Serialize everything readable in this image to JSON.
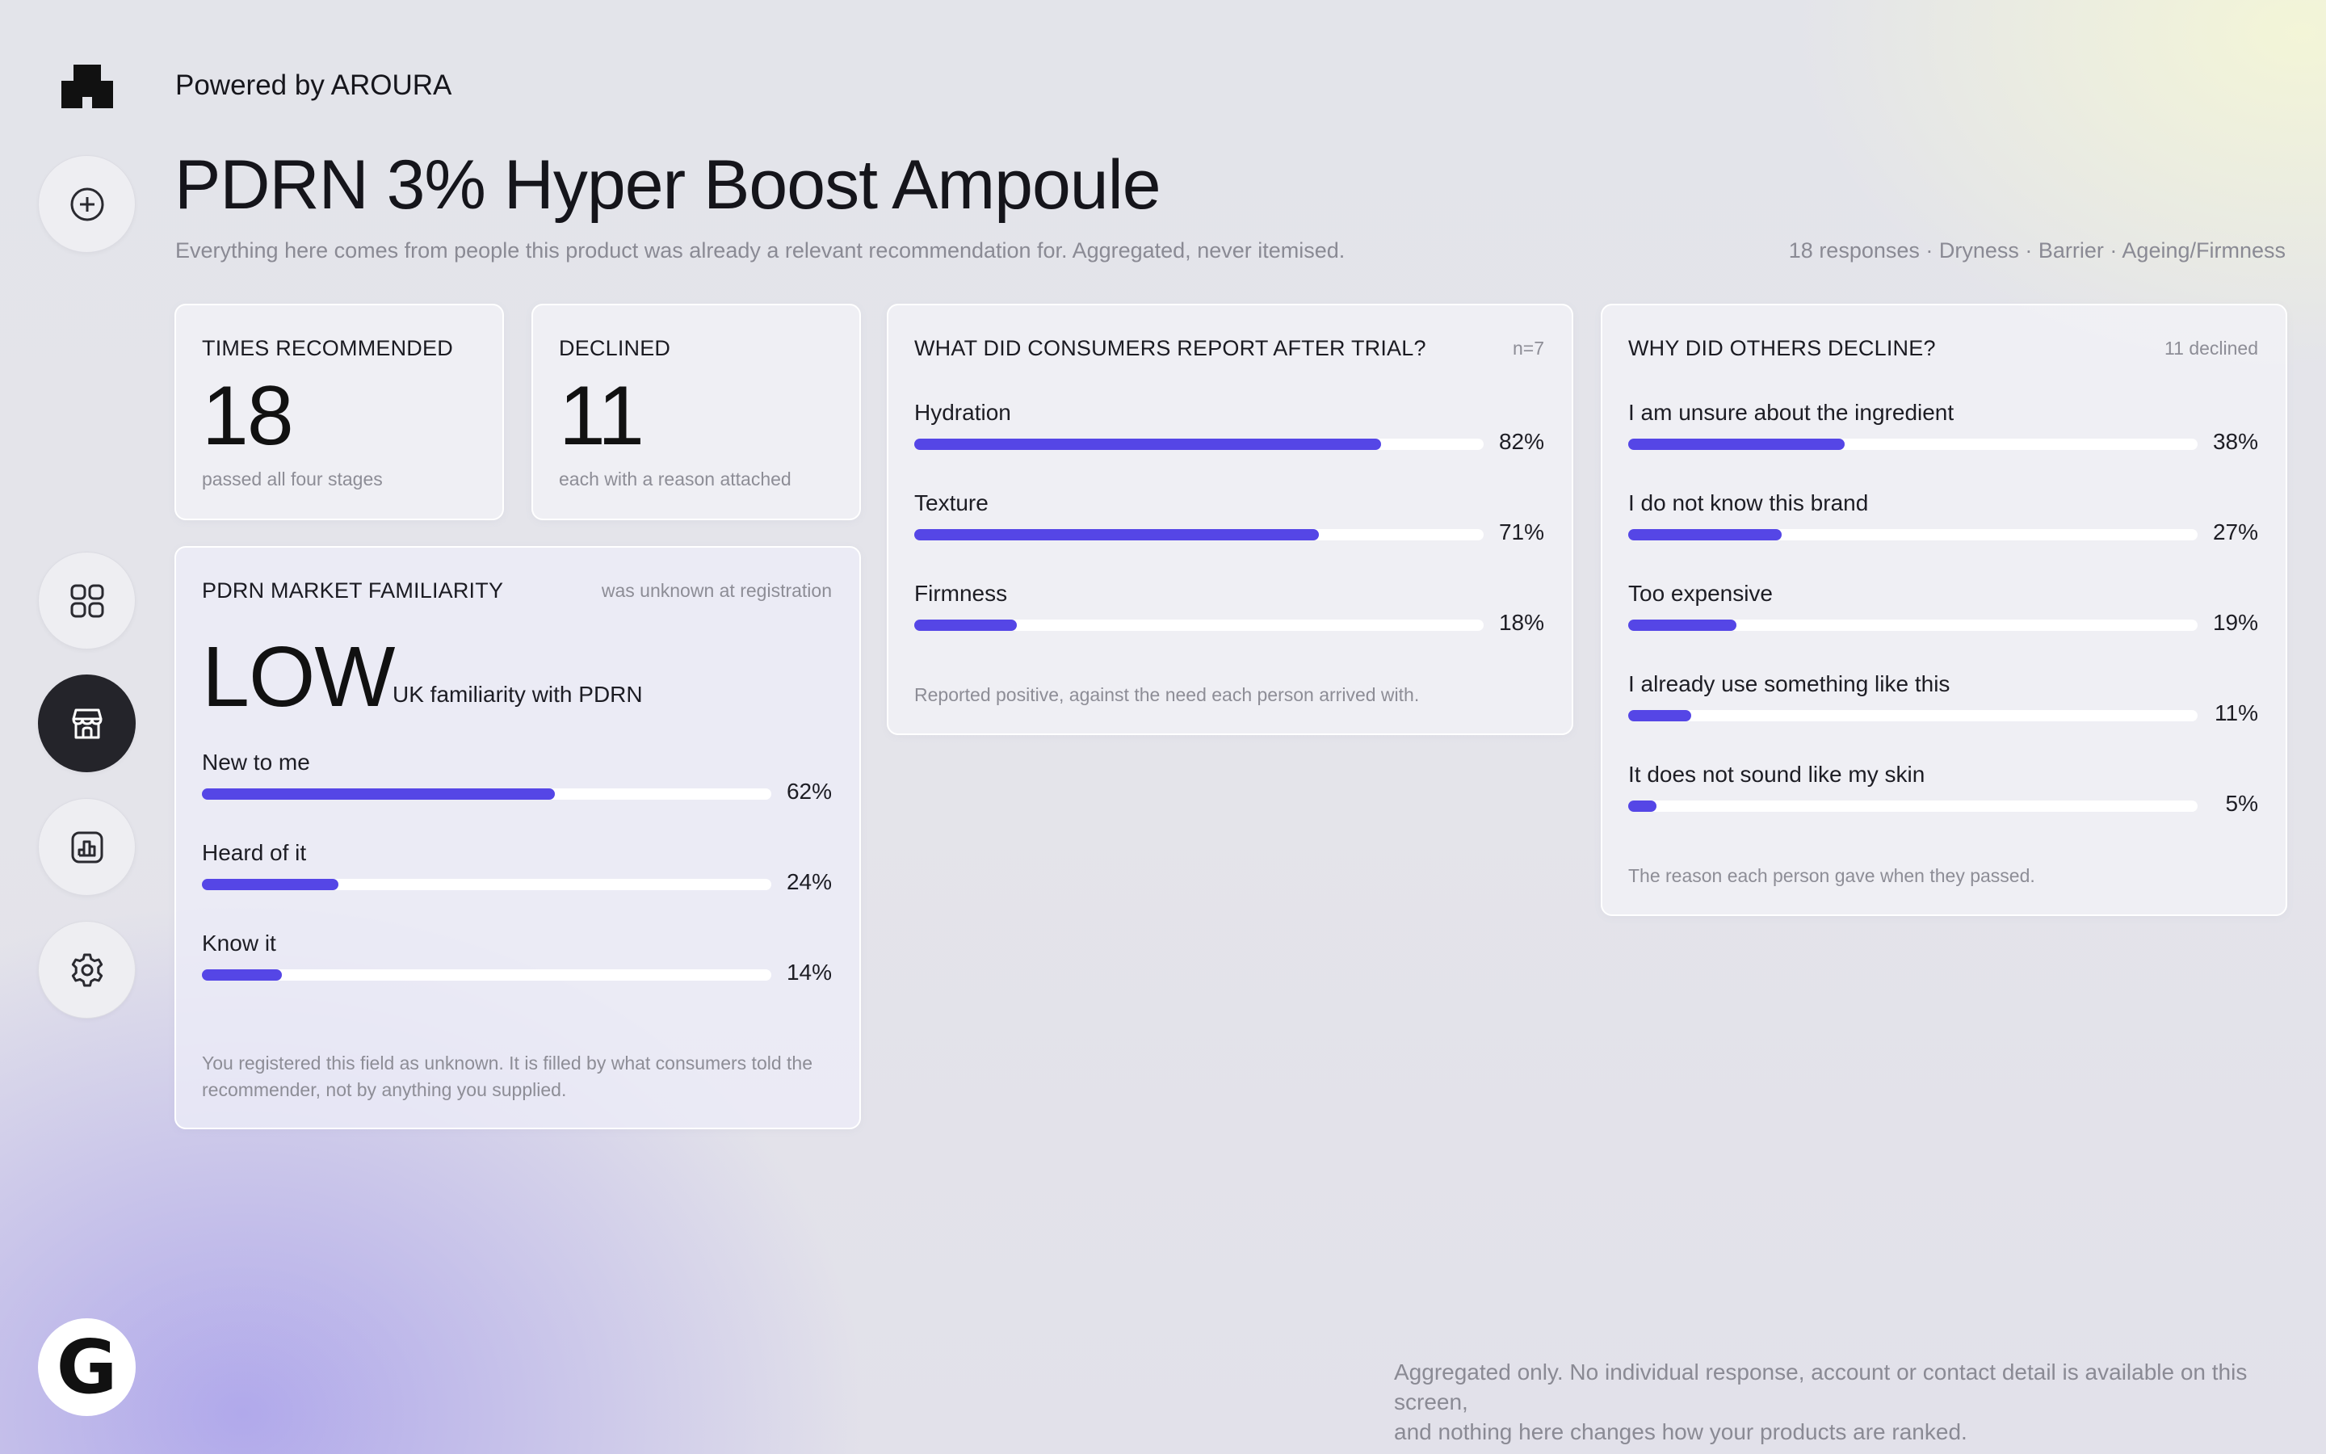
{
  "header": {
    "powered_by": "Powered by AROURA",
    "title": "PDRN 3% Hyper Boost Ampoule",
    "subtitle": "Everything here comes from people this product was already a relevant recommendation for. Aggregated, never itemised.",
    "meta": "18 responses · Dryness · Barrier · Ageing/Firmness"
  },
  "rail": {
    "items": [
      {
        "name": "add",
        "icon": "plus-circle-icon"
      },
      {
        "name": "dashboard",
        "icon": "grid-icon"
      },
      {
        "name": "store",
        "icon": "storefront-icon",
        "active": true
      },
      {
        "name": "analytics",
        "icon": "bar-chart-icon"
      },
      {
        "name": "settings",
        "icon": "gear-icon"
      }
    ],
    "badge": "G"
  },
  "times_recommended": {
    "label": "TIMES RECOMMENDED",
    "value": "18",
    "caption": "passed all four stages"
  },
  "declined": {
    "label": "DECLINED",
    "value": "11",
    "caption": "each with a reason attached"
  },
  "familiarity": {
    "label": "PDRN MARKET FAMILIARITY",
    "note": "was unknown at registration",
    "level": "LOW",
    "level_caption": "UK familiarity with PDRN",
    "rows": [
      {
        "label": "New to me",
        "pct_text": "62%",
        "pct": 62
      },
      {
        "label": "Heard of it",
        "pct_text": "24%",
        "pct": 24
      },
      {
        "label": "Know it",
        "pct_text": "14%",
        "pct": 14
      }
    ],
    "footnote": "You registered this field as unknown. It is filled by what consumers told the recommender, not by anything you supplied."
  },
  "trial": {
    "label": "WHAT DID CONSUMERS REPORT AFTER TRIAL?",
    "note": "n=7",
    "rows": [
      {
        "label": "Hydration",
        "pct_text": "82%",
        "pct": 82
      },
      {
        "label": "Texture",
        "pct_text": "71%",
        "pct": 71
      },
      {
        "label": "Firmness",
        "pct_text": "18%",
        "pct": 18
      }
    ],
    "footnote": "Reported positive, against the need each person arrived with."
  },
  "decline": {
    "label": "WHY DID OTHERS DECLINE?",
    "note": "11 declined",
    "rows": [
      {
        "label": "I am unsure about the ingredient",
        "pct_text": "38%",
        "pct": 38
      },
      {
        "label": "I do not know this brand",
        "pct_text": "27%",
        "pct": 27
      },
      {
        "label": "Too expensive",
        "pct_text": "19%",
        "pct": 19
      },
      {
        "label": "I already use something like this",
        "pct_text": "11%",
        "pct": 11
      },
      {
        "label": "It does not sound like my skin",
        "pct_text": "5%",
        "pct": 5
      }
    ],
    "footnote": "The reason each person gave when they passed."
  },
  "bottom_note": {
    "line1": "Aggregated only. No individual response, account or contact detail is available on this screen,",
    "line2": "and nothing here changes how your products are ranked."
  },
  "colors": {
    "accent": "#5546e6",
    "active_rail": "#24242a"
  }
}
